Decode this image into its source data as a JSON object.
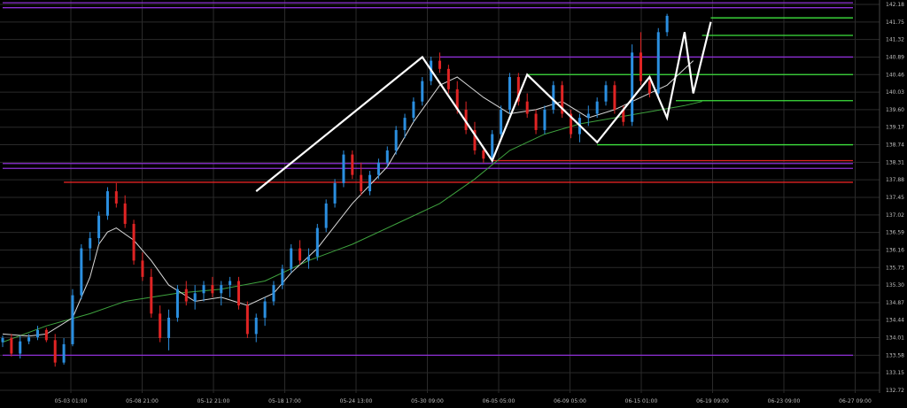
{
  "chart_data": {
    "type": "candlestick",
    "grid": true,
    "y_axis": {
      "position": "right",
      "ticks": [
        "142.18",
        "141.75",
        "141.32",
        "140.89",
        "140.46",
        "140.03",
        "139.60",
        "139.17",
        "138.74",
        "138.31",
        "137.88",
        "137.45",
        "137.02",
        "136.59",
        "136.16",
        "135.73",
        "135.30",
        "134.87",
        "134.44",
        "134.01",
        "133.58",
        "133.15",
        "132.72"
      ],
      "ylim": [
        132.72,
        142.18
      ]
    },
    "x_axis": {
      "ticks": [
        "05-03 01:00",
        "05-08 21:00",
        "05-12 21:00",
        "05-18 17:00",
        "05-24 13:00",
        "05-30 09:00",
        "06-05 05:00",
        "06-09 05:00",
        "06-15 01:00",
        "06-19 09:00",
        "06-23 09:00",
        "06-27 09:00"
      ],
      "range": [
        0,
        100
      ]
    },
    "candles": [
      [
        0,
        133.9,
        134.06,
        133.78,
        134.0
      ],
      [
        1,
        134.0,
        134.1,
        133.55,
        133.62
      ],
      [
        2,
        133.62,
        134.05,
        133.5,
        133.92
      ],
      [
        3,
        133.92,
        134.1,
        133.85,
        134.02
      ],
      [
        4,
        134.02,
        134.3,
        133.95,
        134.2
      ],
      [
        5,
        134.2,
        134.25,
        133.9,
        133.95
      ],
      [
        6,
        133.95,
        134.1,
        133.3,
        133.4
      ],
      [
        7,
        133.4,
        134.0,
        133.35,
        133.85
      ],
      [
        8,
        133.85,
        135.2,
        133.8,
        135.05
      ],
      [
        9,
        135.05,
        136.3,
        134.95,
        136.2
      ],
      [
        10,
        136.2,
        136.6,
        135.9,
        136.45
      ],
      [
        11,
        136.45,
        137.1,
        136.3,
        137.0
      ],
      [
        12,
        137.0,
        137.7,
        136.9,
        137.6
      ],
      [
        13,
        137.6,
        137.8,
        137.2,
        137.3
      ],
      [
        14,
        137.3,
        137.5,
        136.7,
        136.8
      ],
      [
        15,
        136.8,
        136.9,
        135.8,
        135.9
      ],
      [
        16,
        135.9,
        136.1,
        135.4,
        135.5
      ],
      [
        17,
        135.5,
        135.7,
        134.5,
        134.6
      ],
      [
        18,
        134.6,
        134.8,
        133.9,
        134.0
      ],
      [
        19,
        134.0,
        134.7,
        133.7,
        134.5
      ],
      [
        20,
        134.5,
        135.3,
        134.4,
        135.2
      ],
      [
        21,
        135.2,
        135.4,
        134.8,
        134.9
      ],
      [
        22,
        134.9,
        135.3,
        134.7,
        135.1
      ],
      [
        23,
        135.1,
        135.4,
        134.9,
        135.3
      ],
      [
        24,
        135.3,
        135.5,
        135.0,
        135.1
      ],
      [
        25,
        135.1,
        135.4,
        134.8,
        135.3
      ],
      [
        26,
        135.3,
        135.5,
        135.0,
        135.4
      ],
      [
        27,
        135.4,
        135.5,
        134.7,
        134.8
      ],
      [
        28,
        134.8,
        134.9,
        134.0,
        134.1
      ],
      [
        29,
        134.1,
        134.6,
        133.9,
        134.5
      ],
      [
        30,
        134.5,
        135.0,
        134.3,
        134.9
      ],
      [
        31,
        134.9,
        135.4,
        134.8,
        135.3
      ],
      [
        32,
        135.3,
        135.8,
        135.2,
        135.7
      ],
      [
        33,
        135.7,
        136.3,
        135.6,
        136.2
      ],
      [
        34,
        136.2,
        136.4,
        135.8,
        135.9
      ],
      [
        35,
        135.9,
        136.2,
        135.7,
        136.0
      ],
      [
        36,
        136.0,
        136.8,
        135.9,
        136.7
      ],
      [
        37,
        136.7,
        137.4,
        136.6,
        137.3
      ],
      [
        38,
        137.3,
        137.9,
        137.2,
        137.8
      ],
      [
        39,
        137.8,
        138.6,
        137.7,
        138.5
      ],
      [
        40,
        138.5,
        138.6,
        137.9,
        138.0
      ],
      [
        41,
        138.0,
        138.3,
        137.5,
        137.6
      ],
      [
        42,
        137.6,
        138.1,
        137.5,
        138.0
      ],
      [
        43,
        138.0,
        138.4,
        137.9,
        138.3
      ],
      [
        44,
        138.3,
        138.7,
        138.2,
        138.6
      ],
      [
        45,
        138.6,
        139.2,
        138.5,
        139.1
      ],
      [
        46,
        139.1,
        139.5,
        138.9,
        139.4
      ],
      [
        47,
        139.4,
        139.9,
        139.3,
        139.8
      ],
      [
        48,
        139.8,
        140.4,
        139.7,
        140.3
      ],
      [
        49,
        140.3,
        140.9,
        140.2,
        140.8
      ],
      [
        50,
        140.8,
        141.0,
        140.5,
        140.6
      ],
      [
        51,
        140.6,
        140.7,
        140.0,
        140.1
      ],
      [
        52,
        140.1,
        140.3,
        139.5,
        139.6
      ],
      [
        53,
        139.6,
        139.8,
        139.0,
        139.1
      ],
      [
        54,
        139.1,
        139.3,
        138.5,
        138.6
      ],
      [
        55,
        138.6,
        138.7,
        138.3,
        138.4
      ],
      [
        56,
        138.4,
        139.1,
        138.3,
        139.0
      ],
      [
        57,
        139.0,
        139.7,
        138.9,
        139.6
      ],
      [
        58,
        139.6,
        140.5,
        139.5,
        140.4
      ],
      [
        59,
        140.4,
        140.5,
        139.7,
        139.8
      ],
      [
        60,
        139.8,
        140.0,
        139.4,
        139.5
      ],
      [
        61,
        139.5,
        139.6,
        139.0,
        139.1
      ],
      [
        62,
        139.1,
        139.7,
        139.0,
        139.6
      ],
      [
        63,
        139.6,
        140.3,
        139.5,
        140.2
      ],
      [
        64,
        140.2,
        140.3,
        139.4,
        139.5
      ],
      [
        65,
        139.5,
        139.6,
        138.9,
        139.0
      ],
      [
        66,
        139.0,
        139.5,
        138.8,
        139.4
      ],
      [
        67,
        139.4,
        139.7,
        139.2,
        139.5
      ],
      [
        68,
        139.5,
        139.9,
        139.4,
        139.8
      ],
      [
        69,
        139.8,
        140.3,
        139.7,
        140.2
      ],
      [
        70,
        140.2,
        140.3,
        139.5,
        139.6
      ],
      [
        71,
        139.6,
        139.7,
        139.2,
        139.3
      ],
      [
        72,
        139.3,
        141.2,
        139.2,
        141.0
      ],
      [
        73,
        141.0,
        141.5,
        140.2,
        140.3
      ],
      [
        74,
        140.3,
        140.4,
        139.9,
        140.0
      ],
      [
        75,
        140.0,
        141.6,
        139.9,
        141.5
      ],
      [
        76,
        141.5,
        141.95,
        141.4,
        141.9
      ]
    ],
    "zigzag": [
      [
        29,
        137.6
      ],
      [
        48,
        140.89
      ],
      [
        56,
        138.35
      ],
      [
        60,
        140.46
      ],
      [
        68,
        138.8
      ],
      [
        74,
        140.4
      ],
      [
        76,
        139.4
      ],
      [
        78,
        141.5
      ],
      [
        79,
        140.0
      ],
      [
        81,
        141.75
      ]
    ],
    "horizontal_lines": [
      {
        "y": 142.1,
        "x_start": 0,
        "color": "#8e2fd6"
      },
      {
        "y": 142.22,
        "x_start": 0,
        "color": "#8e2fd6"
      },
      {
        "y": 140.89,
        "x_start": 50,
        "color": "#8e2fd6"
      },
      {
        "y": 138.28,
        "x_start": 0,
        "color": "#8e2fd6"
      },
      {
        "y": 138.16,
        "x_start": 0,
        "color": "#8e2fd6"
      },
      {
        "y": 133.58,
        "x_start": 0,
        "color": "#8e2fd6"
      },
      {
        "y": 141.85,
        "x_start": 81,
        "color": "#3ee23e"
      },
      {
        "y": 141.42,
        "x_start": 80,
        "color": "#3ee23e"
      },
      {
        "y": 140.46,
        "x_start": 60,
        "color": "#3ee23e"
      },
      {
        "y": 139.82,
        "x_start": 77,
        "color": "#3ee23e"
      },
      {
        "y": 138.74,
        "x_start": 68,
        "color": "#3ee23e"
      },
      {
        "y": 138.35,
        "x_start": 56,
        "color": "#e02424"
      },
      {
        "y": 137.82,
        "x_start": 7,
        "color": "#e02424"
      }
    ],
    "ma_fast": [
      [
        0,
        134.1
      ],
      [
        3,
        134.05
      ],
      [
        5,
        134.1
      ],
      [
        8,
        134.5
      ],
      [
        10,
        135.5
      ],
      [
        11,
        136.3
      ],
      [
        12,
        136.6
      ],
      [
        13,
        136.7
      ],
      [
        15,
        136.4
      ],
      [
        17,
        135.9
      ],
      [
        19,
        135.3
      ],
      [
        22,
        134.9
      ],
      [
        25,
        135.0
      ],
      [
        28,
        134.8
      ],
      [
        31,
        135.1
      ],
      [
        33,
        135.6
      ],
      [
        36,
        136.2
      ],
      [
        40,
        137.3
      ],
      [
        44,
        138.2
      ],
      [
        47,
        139.3
      ],
      [
        50,
        140.2
      ],
      [
        52,
        140.4
      ],
      [
        55,
        139.9
      ],
      [
        58,
        139.5
      ],
      [
        61,
        139.6
      ],
      [
        64,
        139.8
      ],
      [
        67,
        139.4
      ],
      [
        70,
        139.6
      ],
      [
        73,
        139.9
      ],
      [
        76,
        140.2
      ],
      [
        78,
        140.6
      ],
      [
        79,
        140.8
      ]
    ],
    "ma_slow": [
      [
        0,
        133.9
      ],
      [
        5,
        134.3
      ],
      [
        10,
        134.6
      ],
      [
        14,
        134.9
      ],
      [
        20,
        135.1
      ],
      [
        25,
        135.2
      ],
      [
        30,
        135.4
      ],
      [
        35,
        135.9
      ],
      [
        40,
        136.3
      ],
      [
        45,
        136.8
      ],
      [
        50,
        137.3
      ],
      [
        54,
        137.9
      ],
      [
        58,
        138.6
      ],
      [
        62,
        139.0
      ],
      [
        66,
        139.25
      ],
      [
        70,
        139.4
      ],
      [
        74,
        139.55
      ],
      [
        78,
        139.7
      ],
      [
        80,
        139.8
      ]
    ],
    "colors": {
      "bull": "#2b8fe0",
      "bear": "#e02424",
      "zigzag": "#ffffff",
      "ma_fast": "#d8d8d8",
      "ma_slow": "#3fa33f",
      "grid": "#2a2a2a",
      "axis_text": "#bdbdbd"
    }
  }
}
